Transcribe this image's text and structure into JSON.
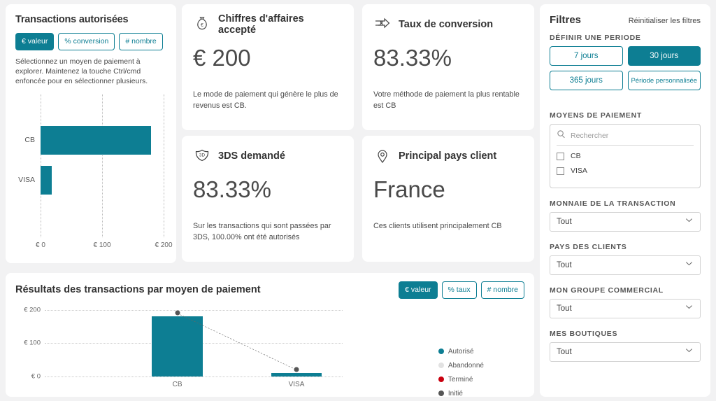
{
  "accent": "#0d7e93",
  "background": "#f2f2f3",
  "auth_card": {
    "title": "Transactions autorisées",
    "toggles": [
      {
        "label": "€ valeur",
        "active": true
      },
      {
        "label": "% conversion",
        "active": false
      },
      {
        "label": "# nombre",
        "active": false
      }
    ],
    "hint": "Sélectionnez un moyen de paiement à explorer. Maintenez la touche Ctrl/cmd enfoncée pour en sélectionner plusieurs."
  },
  "kpis": [
    {
      "id": "revenue",
      "icon": "money-bag-icon",
      "title": "Chiffres d'affaires accepté",
      "value": "€ 200",
      "description": "Le mode de paiement qui génère le plus de revenus est CB."
    },
    {
      "id": "conversion",
      "icon": "conversion-funnel-icon",
      "title": "Taux de conversion",
      "value": "83.33%",
      "description": "Votre méthode de paiement la plus rentable est CB"
    },
    {
      "id": "3ds",
      "icon": "shield-3d-icon",
      "title": "3DS demandé",
      "value": "83.33%",
      "description": "Sur les transactions qui sont passées par 3DS, 100.00% ont été autorisés"
    },
    {
      "id": "country",
      "icon": "map-pin-icon",
      "title": "Principal pays client",
      "value": "France",
      "description": "Ces clients utilisent principalement CB"
    }
  ],
  "filters": {
    "title": "Filtres",
    "reset_label": "Réinitialiser les filtres",
    "period_label": "DÉFINIR UNE PERIODE",
    "period_buttons": [
      {
        "label": "7 jours",
        "active": false
      },
      {
        "label": "30 jours",
        "active": true
      },
      {
        "label": "365 jours",
        "active": false
      },
      {
        "label": "Période personnalisée",
        "active": false
      }
    ],
    "payment_methods_label": "MOYENS DE PAIEMENT",
    "search_placeholder": "Rechercher",
    "payment_methods": [
      {
        "label": "CB",
        "checked": false
      },
      {
        "label": "VISA",
        "checked": false
      }
    ],
    "currency_label": "MONNAIE DE LA TRANSACTION",
    "currency_value": "Tout",
    "client_country_label": "PAYS DES CLIENTS",
    "client_country_value": "Tout",
    "commercial_group_label": "MON GROUPE COMMERCIAL",
    "commercial_group_value": "Tout",
    "shops_label": "MES BOUTIQUES",
    "shops_value": "Tout"
  },
  "bottom_chart_card": {
    "title": "Résultats des transactions par moyen de paiement",
    "toggles": [
      {
        "label": "€ valeur",
        "active": true
      },
      {
        "label": "% taux",
        "active": false
      },
      {
        "label": "# nombre",
        "active": false
      }
    ]
  },
  "chart_data": [
    {
      "type": "bar",
      "orientation": "horizontal",
      "title": "Transactions autorisées",
      "categories": [
        "CB",
        "VISA"
      ],
      "values": [
        180,
        18
      ],
      "xlabel": "",
      "ylabel": "",
      "xlim": [
        0,
        200
      ],
      "xticks": [
        0,
        100,
        200
      ],
      "xtick_labels": [
        "€ 0",
        "€ 100",
        "€ 200"
      ],
      "grid": true,
      "series_color": "#0d7e93"
    },
    {
      "type": "bar",
      "orientation": "vertical",
      "title": "Résultats des transactions par moyen de paiement",
      "categories": [
        "CB",
        "VISA"
      ],
      "series": [
        {
          "name": "Autorisé",
          "values": [
            180,
            10
          ],
          "color": "#0d7e93"
        },
        {
          "name": "Initié",
          "values": [
            190,
            20
          ],
          "color": "#555555",
          "style": "dashed-line"
        }
      ],
      "legend": [
        {
          "label": "Autorisé",
          "color": "#0d7e93"
        },
        {
          "label": "Abandonné",
          "color": "#e2e2e2"
        },
        {
          "label": "Terminé",
          "color": "#c9000f"
        },
        {
          "label": "Initié",
          "color": "#555555"
        }
      ],
      "legend_position": "right",
      "ylim": [
        0,
        200
      ],
      "yticks": [
        0,
        100,
        200
      ],
      "ytick_labels": [
        "€ 0",
        "€ 100",
        "€ 200"
      ],
      "xlabel": "",
      "ylabel": "",
      "grid": true
    }
  ]
}
